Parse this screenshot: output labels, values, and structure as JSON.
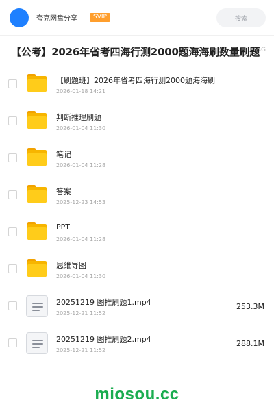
{
  "header": {
    "user_name": "夸克网盘分享",
    "badge": "SVIP",
    "search_placeholder": "搜索"
  },
  "folder": {
    "title": "【公考】2026年省考四海行测2000题海海刷数量刷题",
    "size": "3.4G"
  },
  "items": [
    {
      "type": "folder",
      "icon": "folder-icon",
      "name": "【刷题班】2026年省考四海行测2000题海海刷",
      "date": "2026-01-18 14:21",
      "size": ""
    },
    {
      "type": "folder",
      "icon": "folder-icon",
      "name": "判断推理刷题",
      "date": "2026-01-04 11:30",
      "size": ""
    },
    {
      "type": "folder",
      "icon": "folder-icon",
      "name": "笔记",
      "date": "2026-01-04 11:28",
      "size": ""
    },
    {
      "type": "folder",
      "icon": "folder-icon",
      "name": "答案",
      "date": "2025-12-23 14:53",
      "size": ""
    },
    {
      "type": "folder",
      "icon": "folder-icon",
      "name": "PPT",
      "date": "2026-01-04 11:28",
      "size": ""
    },
    {
      "type": "folder",
      "icon": "folder-icon",
      "name": "思维导图",
      "date": "2026-01-04 11:30",
      "size": ""
    },
    {
      "type": "file",
      "icon": "video-file-icon",
      "name": "20251219 图推刷题1.mp4",
      "date": "2025-12-21 11:52",
      "size": "253.3M"
    },
    {
      "type": "file",
      "icon": "video-file-icon",
      "name": "20251219 图推刷题2.mp4",
      "date": "2025-12-21 11:52",
      "size": "288.1M"
    }
  ],
  "footer": {
    "brand": "miosou.cc"
  },
  "colors": {
    "avatar": "#1e80ff",
    "badge": "#ff9e2c",
    "folder": "#ffcc1a",
    "brand": "#1aac4f"
  }
}
